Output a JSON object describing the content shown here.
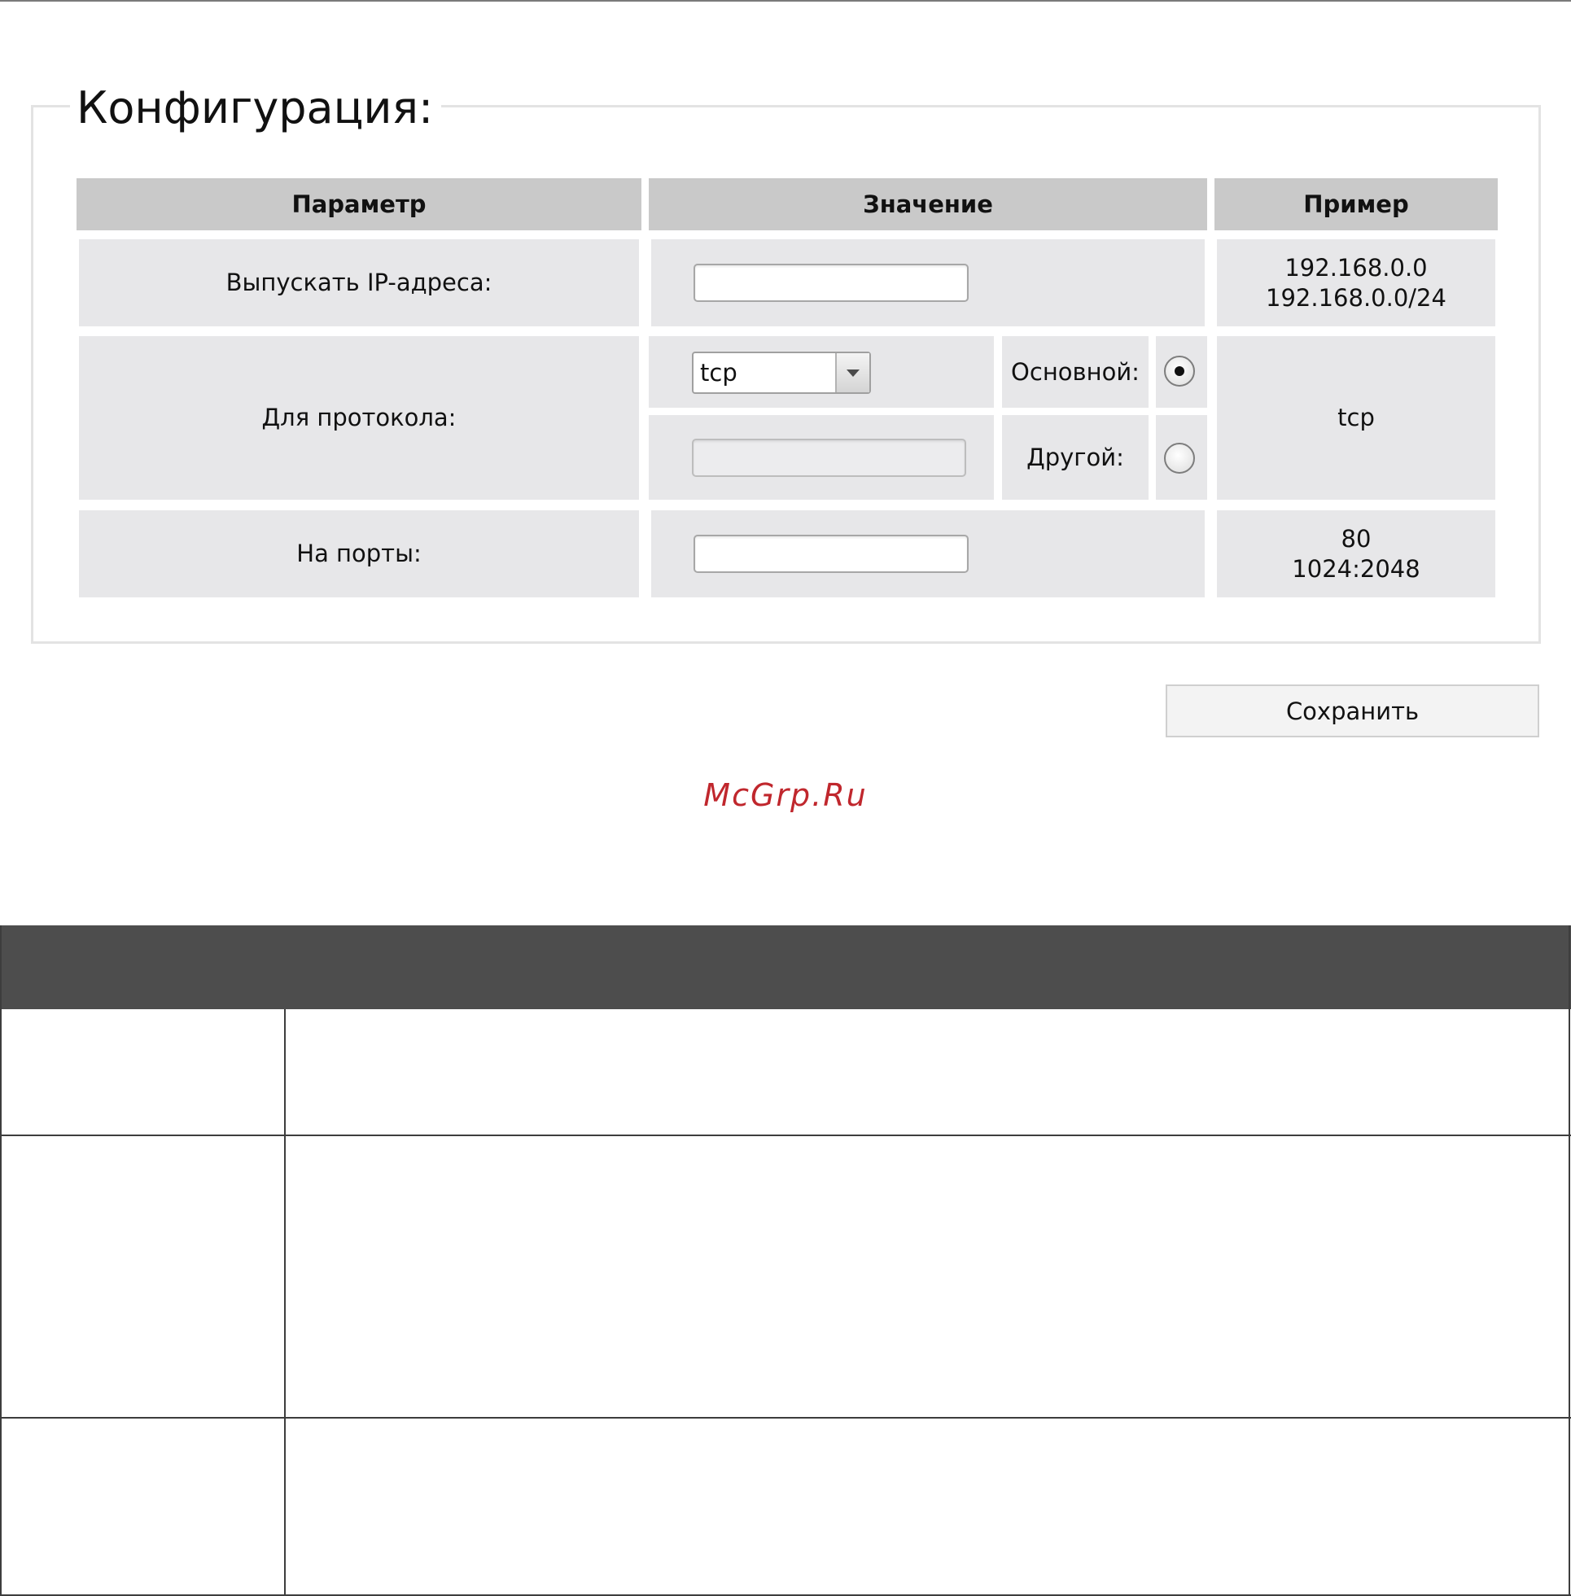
{
  "config": {
    "title": "Конфигурация:",
    "headers": {
      "parameter": "Параметр",
      "value": "Значение",
      "example": "Пример"
    },
    "rows": {
      "skip_ip": {
        "label": "Выпускать IP-адреса:",
        "value": "",
        "example_line1": "192.168.0.0",
        "example_line2": "192.168.0.0/24"
      },
      "protocol": {
        "label": "Для протокола:",
        "select_value": "tcp",
        "main_label": "Основной:",
        "other_label": "Другой:",
        "other_value": "",
        "selected_option": "main",
        "example": "tcp"
      },
      "ports": {
        "label": "На порты:",
        "value": "",
        "example_line1": "80",
        "example_line2": "1024:2048"
      }
    },
    "save_label": "Сохранить"
  },
  "watermark": "McGrp.Ru",
  "icons": {
    "select_arrow": "chevron-down-icon",
    "radio_selected": "radio-selected-icon",
    "radio_unselected": "radio-unselected-icon"
  },
  "colors": {
    "cell_background": "#e7e7e9",
    "header_background": "#c9c9c9",
    "watermark": "#c0272d",
    "doc_table_header": "#4d4d4d"
  }
}
